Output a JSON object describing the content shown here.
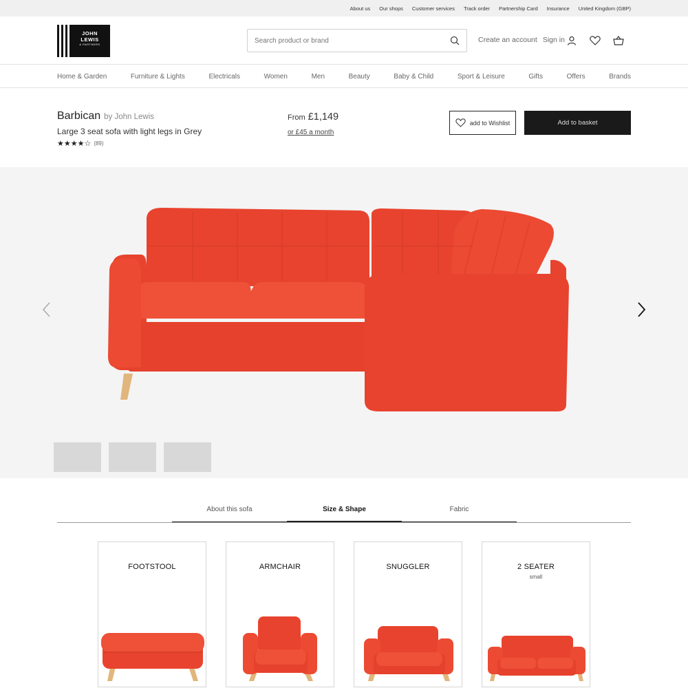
{
  "topbar": {
    "links": [
      "About us",
      "Our shops",
      "Customer services",
      "Track order",
      "Partnership Card",
      "Insurance",
      "United Kingdom (GBP)"
    ]
  },
  "header": {
    "logo": {
      "line1": "JOHN",
      "line2": "LEWIS",
      "line3": "& PARTNERS"
    },
    "search_placeholder": "Search product or brand",
    "create_account": "Create an account",
    "sign_in": "Sign in",
    "icons": [
      "account-icon",
      "wishlist-heart-icon",
      "basket-icon"
    ]
  },
  "nav": {
    "items": [
      "Home & Garden",
      "Furniture & Lights",
      "Electricals",
      "Women",
      "Men",
      "Beauty",
      "Baby & Child",
      "Sport & Leisure",
      "Gifts",
      "Offers",
      "Brands"
    ]
  },
  "product": {
    "name": "Barbican",
    "brand": "by John Lewis",
    "subtitle": "Large 3 seat sofa with light legs in Grey",
    "rating": 3.5,
    "stars": "★★★★☆",
    "review_count": "(89)",
    "price_from": "From",
    "price": "£1,149",
    "monthly": "or £45 a month",
    "wishlist_label": "add to Wishlist",
    "basket_label": "Add to basket"
  },
  "gallery": {
    "image": "orange-corner-sofa",
    "thumbnails_count": 3,
    "colors": {
      "sofa": "#ec4a33",
      "legs": "#e1b67c",
      "background": "#f4f4f4"
    }
  },
  "tabs": [
    {
      "label": "About this sofa",
      "active": false
    },
    {
      "label": "Size & Shape",
      "active": true
    },
    {
      "label": "Fabric",
      "active": false
    }
  ],
  "size_cards": [
    {
      "title": "FOOTSTOOL",
      "subtitle": ""
    },
    {
      "title": "ARMCHAIR",
      "subtitle": ""
    },
    {
      "title": "SNUGGLER",
      "subtitle": ""
    },
    {
      "title": "2 SEATER",
      "subtitle": "small"
    }
  ]
}
